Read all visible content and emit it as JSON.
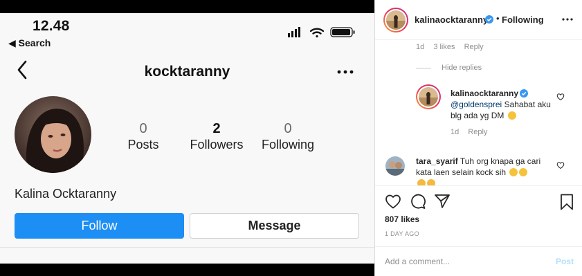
{
  "phone": {
    "time": "12.48",
    "back_app": "◀ Search",
    "username": "kocktaranny",
    "stats": [
      {
        "value": "0",
        "label": "Posts"
      },
      {
        "value": "2",
        "label": "Followers"
      },
      {
        "value": "0",
        "label": "Following"
      }
    ],
    "display_name": "Kalina Ocktaranny",
    "follow_label": "Follow",
    "message_label": "Message",
    "icons": [
      "signal-icon",
      "wifi-icon",
      "battery-icon",
      "back-chevron-icon",
      "more-dots-icon"
    ]
  },
  "post": {
    "header": {
      "username": "kalinaocktaranny",
      "separator": "•",
      "follow_state": "Following"
    },
    "comment1_meta": {
      "age": "1d",
      "likes": "3 likes",
      "reply": "Reply"
    },
    "hide_replies": "Hide replies",
    "reply": {
      "username": "kalinaocktaranny",
      "mention": "@goldensprei",
      "text": " Sahabat aku blg ada yg DM ",
      "age": "1d",
      "reply": "Reply"
    },
    "comment2": {
      "username": "tara_syarif",
      "text": " Tuh org knapa ga cari kata laen selain kock sih "
    },
    "likes": "807 likes",
    "time_ago": "1 DAY AGO",
    "comment_placeholder": "Add a comment...",
    "post_label": "Post",
    "colors": {
      "follow_blue": "#1d8ef3",
      "verified_blue": "#3897f0",
      "post_disabled": "#b2dffc"
    }
  }
}
